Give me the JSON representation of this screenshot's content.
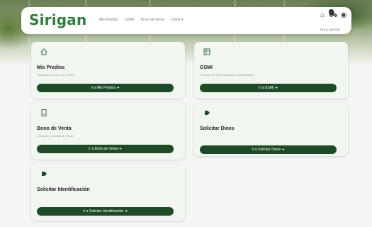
{
  "header": {
    "logo": "Sirigan",
    "nav": [
      "Mis Predios",
      "GSMI",
      "Bono de Venta",
      "Dines ▾"
    ],
    "cart_count": "0",
    "user": "HOLA, ANTONI"
  },
  "cards": [
    {
      "icon": "house-icon",
      "title": "Mis Predios",
      "description": "Visualiza predios a su nombre",
      "button": "Ir a Mis Predios ➜"
    },
    {
      "icon": "document-grid-icon",
      "title": "GSMI",
      "description": "Creación de Guía Sanitaria de Movilización",
      "button": "Ir a GSMI ➜"
    },
    {
      "icon": "receipt-icon",
      "title": "Bono de Venta",
      "description": "Creación de Bonos de Venta",
      "button": "Ir a Bono de Venta ➜"
    },
    {
      "icon": "tag-icon",
      "title": "Solicitar Dines",
      "description": "",
      "button": "Ir a Solicitar Dines ➜"
    },
    {
      "icon": "tag-icon",
      "title": "Solicitar Identificación",
      "description": "",
      "button": "Ir a Solicitar Identificación ➜"
    }
  ],
  "colors": {
    "brand": "#2e7d3b",
    "button": "#1f4a28",
    "card": "#f1f6f1"
  }
}
